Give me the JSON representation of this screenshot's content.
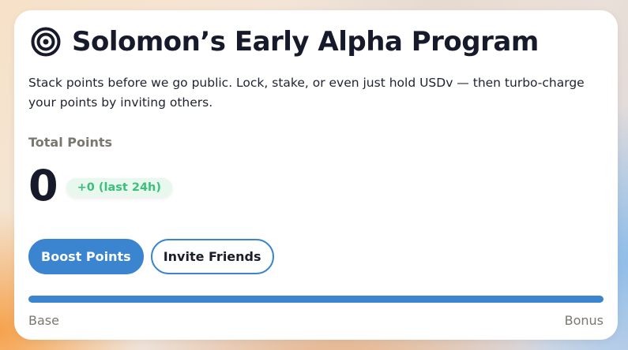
{
  "program": {
    "icon": "target-icon",
    "title": "Solomon’s Early Alpha Program",
    "description": "Stack points before we go public. Lock, stake, or even just hold USDv — then turbo-charge your points by inviting others."
  },
  "points": {
    "label": "Total Points",
    "value": "0",
    "delta_badge": "+0 (last 24h)"
  },
  "actions": {
    "boost_label": "Boost Points",
    "invite_label": "Invite Friends"
  },
  "progress": {
    "fill_fraction": 1.0,
    "start_label": "Base",
    "end_label": "Bonus"
  },
  "colors": {
    "accent": "#3a84d0",
    "badge_text": "#3bbf7a",
    "badge_bg": "#e9f8ef",
    "title_text": "#161a2b",
    "muted_text": "#7a7770"
  }
}
